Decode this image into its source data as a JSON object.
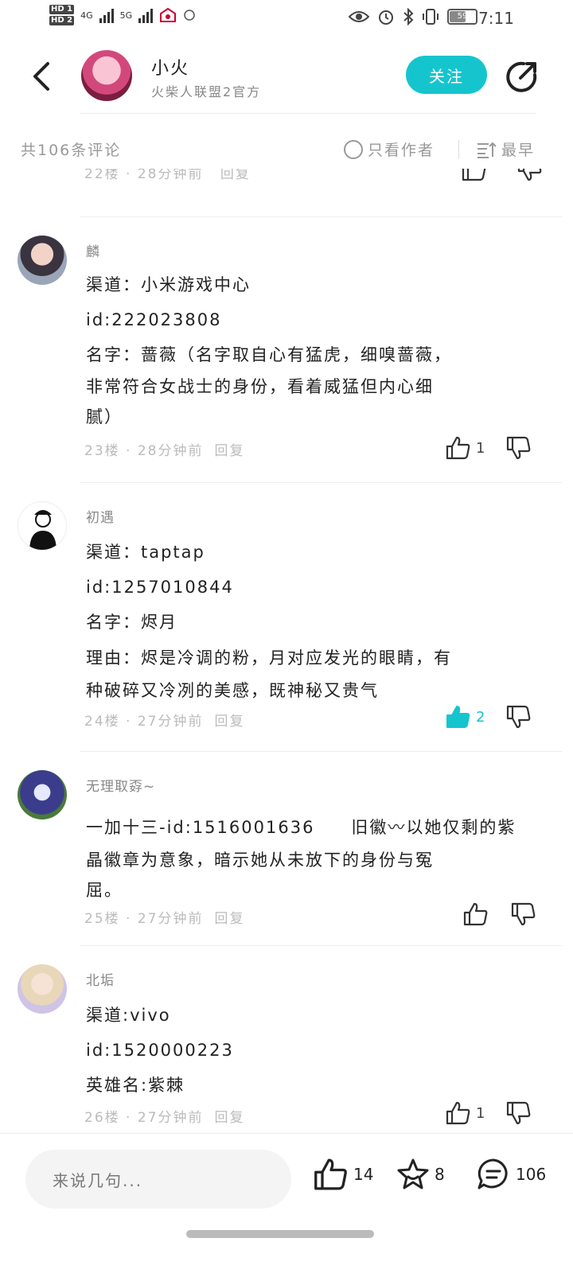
{
  "status": {
    "time": "7:11",
    "hd1": "HD 1",
    "hd2": "HD 2",
    "net1": "4G",
    "net2": "5G",
    "battery": "59"
  },
  "header": {
    "title": "小火",
    "subtitle": "火柴人联盟2官方",
    "follow_label": "关注"
  },
  "filter": {
    "count_label": "共106条评论",
    "author_only_label": "只看作者",
    "sort_label": "最早"
  },
  "partial_comment": {
    "meta": "22楼 · 28分钟前",
    "reply": "回复"
  },
  "comments": [
    {
      "name": "麟",
      "lines": [
        "渠道：小米游戏中心",
        "id:222023808",
        "名字：蔷薇（名字取自心有猛虎，细嗅蔷薇，",
        "非常符合女战士的身份，看着威猛但内心细",
        "腻）"
      ],
      "meta": "23楼 · 28分钟前",
      "reply": "回复",
      "likes": "1",
      "liked": false
    },
    {
      "name": "初遇",
      "lines": [
        "渠道：taptap",
        "id:1257010844",
        "名字：烬月",
        "理由：烬是冷调的粉，月对应发光的眼睛，有",
        "种破碎又冷冽的美感，既神秘又贵气"
      ],
      "meta": "24楼 · 27分钟前",
      "reply": "回复",
      "likes": "2",
      "liked": true
    },
    {
      "name": "无理取孬~",
      "lines": [
        "一加十三-id:1516001636　　旧徽〰以她仅剩的紫",
        "晶徽章为意象，暗示她从未放下的身份与冤",
        "屈。"
      ],
      "meta": "25楼 · 27分钟前",
      "reply": "回复",
      "likes": "",
      "liked": false
    },
    {
      "name": "北垢",
      "lines": [
        "渠道:vivo",
        "id:1520000223",
        "英雄名:紫棘"
      ],
      "meta": "26楼 · 27分钟前",
      "reply": "回复",
      "likes": "1",
      "liked": false
    }
  ],
  "bottom": {
    "input_placeholder": "来说几句...",
    "likes": "14",
    "favorites": "8",
    "comments": "106"
  },
  "colors": {
    "accent": "#15c5ce",
    "text": "#222222",
    "muted": "#999999"
  }
}
